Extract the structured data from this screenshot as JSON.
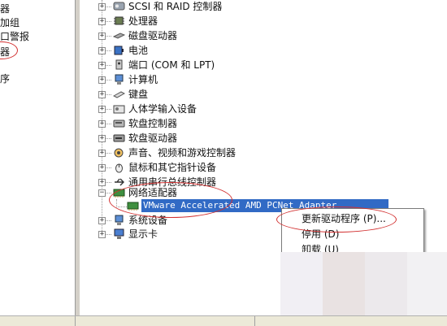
{
  "left_pane": {
    "items": [
      "器",
      "加组",
      "口警报",
      "器",
      "序"
    ]
  },
  "tree": {
    "items": [
      {
        "label": "SCSI 和 RAID 控制器",
        "icon": "scsi-icon",
        "expander": "+"
      },
      {
        "label": "处理器",
        "icon": "processor-icon",
        "expander": "+"
      },
      {
        "label": "磁盘驱动器",
        "icon": "disk-icon",
        "expander": "+"
      },
      {
        "label": "电池",
        "icon": "battery-icon",
        "expander": "+"
      },
      {
        "label": "端口 (COM 和 LPT)",
        "icon": "port-icon",
        "expander": "+"
      },
      {
        "label": "计算机",
        "icon": "computer-icon",
        "expander": "+"
      },
      {
        "label": "键盘",
        "icon": "keyboard-icon",
        "expander": "+"
      },
      {
        "label": "人体学输入设备",
        "icon": "hid-icon",
        "expander": "+"
      },
      {
        "label": "软盘控制器",
        "icon": "floppy-controller-icon",
        "expander": "+"
      },
      {
        "label": "软盘驱动器",
        "icon": "floppy-drive-icon",
        "expander": "+"
      },
      {
        "label": "声音、视频和游戏控制器",
        "icon": "sound-icon",
        "expander": "+"
      },
      {
        "label": "鼠标和其它指针设备",
        "icon": "mouse-icon",
        "expander": "+"
      },
      {
        "label": "通用串行总线控制器",
        "icon": "usb-icon",
        "expander": "+"
      },
      {
        "label": "网络适配器",
        "icon": "network-adapter-icon",
        "expander": "−"
      },
      {
        "label": "系统设备",
        "icon": "system-icon",
        "expander": "+"
      },
      {
        "label": "显示卡",
        "icon": "display-icon",
        "expander": "+"
      }
    ],
    "selected_child": "VMware Accelerated AMD PCNet Adapter"
  },
  "context_menu": {
    "items": [
      "更新驱动程序 (P)...",
      "停用 (D)",
      "卸载 (U)"
    ]
  },
  "colors": {
    "selection": "#316ac5",
    "annotation_red": "#d23030"
  }
}
